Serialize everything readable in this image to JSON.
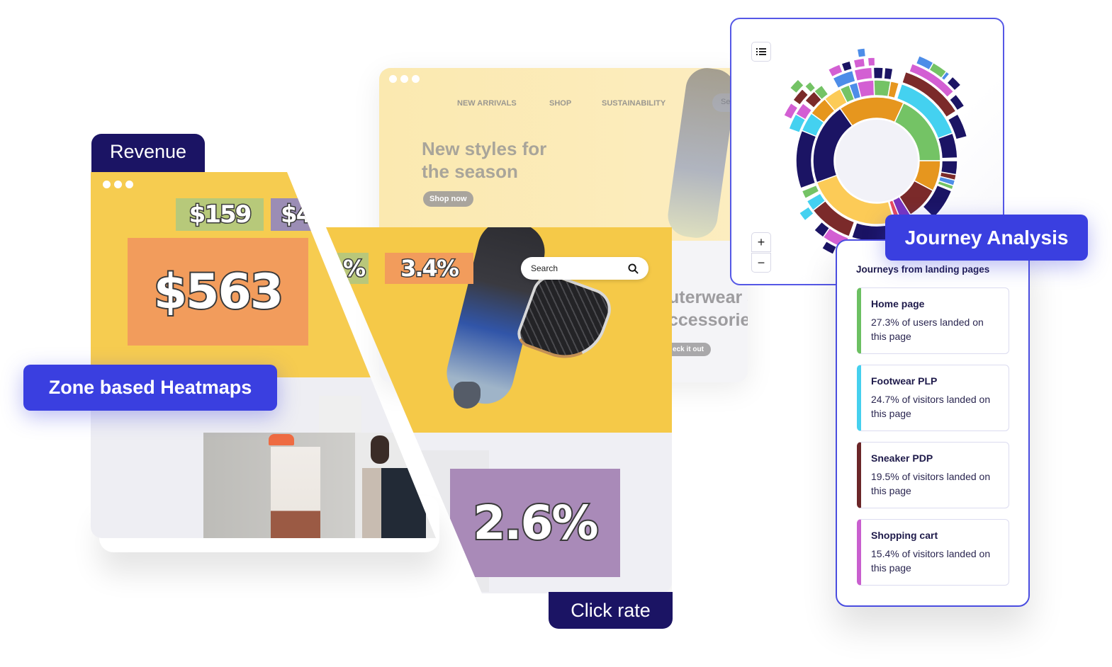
{
  "site": {
    "nav": [
      "NEW ARRIVALS",
      "SHOP",
      "SUSTAINABILITY"
    ],
    "search_partial": "Se",
    "hero_title": "New styles for the season",
    "hero_button": "Shop now",
    "outerwear_title": "uterwear and ccessories",
    "outerwear_button": "eck it out",
    "search_placeholder": "Search"
  },
  "heatmap": {
    "tab_label": "Revenue",
    "badge": "Zone based Heatmaps",
    "zones": [
      {
        "value": "$159",
        "color": "#b7c97a"
      },
      {
        "value": "$4",
        "color": "#9b8db5"
      },
      {
        "value": "$563",
        "color": "#f29c5c"
      }
    ]
  },
  "clickrate": {
    "tab_label": "Click rate",
    "zones": [
      {
        "value": "%",
        "color": "#b9c77a"
      },
      {
        "value": "3.4%",
        "color": "#f29c5c"
      },
      {
        "value": "2.6%",
        "color": "#a98ab8"
      }
    ]
  },
  "journey": {
    "badge": "Journey Analysis",
    "controls": {
      "list": "list-icon",
      "zoom_in": "+",
      "zoom_out": "−"
    },
    "card_title": "Journeys from landing pages",
    "items": [
      {
        "name": "Home page",
        "desc": "27.3% of users landed on this page",
        "color": "#6cc062"
      },
      {
        "name": "Footwear PLP",
        "desc": "24.7% of visitors landed on this page",
        "color": "#45d0ee"
      },
      {
        "name": "Sneaker PDP",
        "desc": "19.5% of visitors landed on this page",
        "color": "#6b2628"
      },
      {
        "name": "Shopping cart",
        "desc": "15.4% of visitors landed on this page",
        "color": "#c95fcf"
      }
    ]
  },
  "colors": {
    "accent": "#3a3fe0",
    "navy": "#1b1464"
  }
}
